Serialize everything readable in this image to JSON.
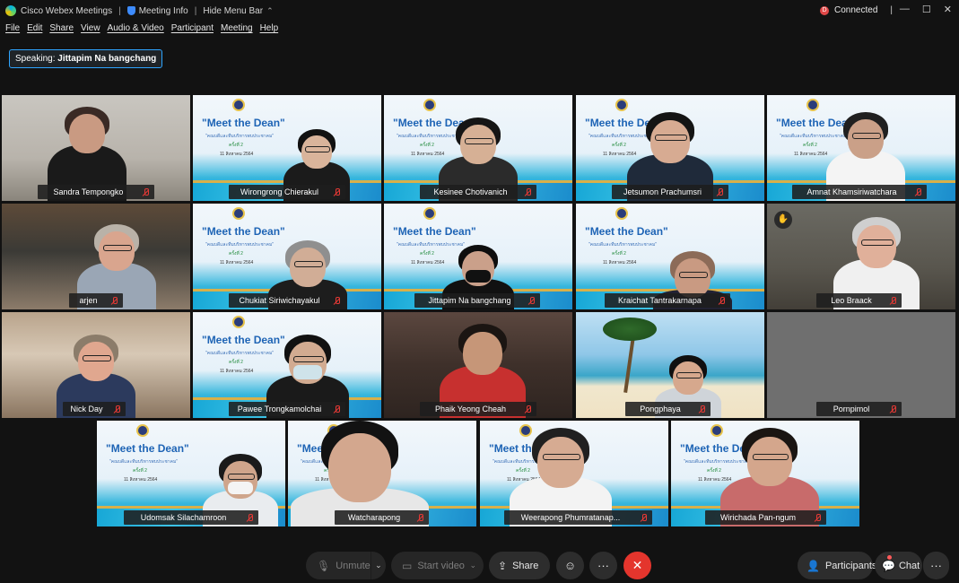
{
  "titlebar": {
    "app": "Cisco Webex Meetings",
    "meeting_info": "Meeting Info",
    "hide_menu": "Hide Menu Bar",
    "status": "Connected",
    "status_letter": "D",
    "win_min": "—",
    "win_max": "☐",
    "win_close": "✕"
  },
  "menu": [
    "File",
    "Edit",
    "Share",
    "View",
    "Audio & Video",
    "Participant",
    "Meeting",
    "Help"
  ],
  "speaking": {
    "label": "Speaking:",
    "name": "Jittapim Na bangchang"
  },
  "slide": {
    "title": "\"Meet the Dean\"",
    "sub": "\"คณบดีและทีมบริหารพบประชาคม\"",
    "round": "ครั้งที่ 2",
    "date": "11 สิงหาคม 2564"
  },
  "participants": [
    {
      "name": "Sandra Tempongko"
    },
    {
      "name": "Wirongrong Chierakul"
    },
    {
      "name": "Kesinee Chotivanich"
    },
    {
      "name": "Jetsumon Prachumsri"
    },
    {
      "name": "Amnat Khamsiriwatchara"
    },
    {
      "name": "arjen"
    },
    {
      "name": "Chukiat Siriwichayakul"
    },
    {
      "name": "Jittapim Na bangchang"
    },
    {
      "name": "Kraichat Tantrakarnapa"
    },
    {
      "name": "Leo Braack"
    },
    {
      "name": "Nick Day"
    },
    {
      "name": "Pawee Trongkamolchai"
    },
    {
      "name": "Phaik Yeong Cheah"
    },
    {
      "name": "Pongphaya"
    },
    {
      "name": "Pornpimol"
    },
    {
      "name": "Udomsak Silachamroon"
    },
    {
      "name": "Watcharapong"
    },
    {
      "name": "Weerapong Phumratanap..."
    },
    {
      "name": "Wirichada Pan-ngum"
    }
  ],
  "controls": {
    "unmute": "Unmute",
    "start_video": "Start video",
    "share": "Share",
    "participants": "Participants",
    "chat": "Chat"
  },
  "colors": {
    "accent": "#2fa5ff",
    "end": "#e4352d",
    "muted": "#e53935"
  }
}
